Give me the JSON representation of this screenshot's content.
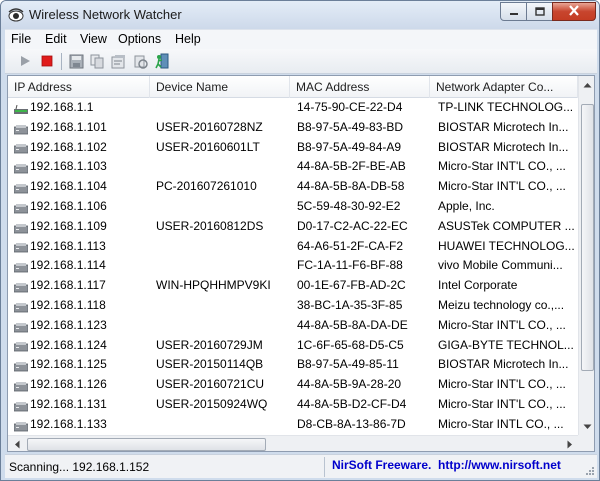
{
  "window": {
    "title": "Wireless Network Watcher",
    "controls": {
      "minimize": "minimize",
      "maximize": "maximize",
      "close": "close"
    }
  },
  "menu": [
    "File",
    "Edit",
    "View",
    "Options",
    "Help"
  ],
  "toolbar": {
    "icons": [
      "play-icon",
      "stop-icon",
      "save-icon",
      "copy-icon",
      "properties-icon",
      "refresh-icon",
      "exit-icon"
    ]
  },
  "table": {
    "columns": [
      "IP Address",
      "Device Name",
      "MAC Address",
      "Network Adapter Co..."
    ],
    "rows": [
      {
        "ip": "192.168.1.1",
        "device": "",
        "mac": "14-75-90-CE-22-D4",
        "vendor": "TP-LINK TECHNOLOG...",
        "icon": "router-icon"
      },
      {
        "ip": "192.168.1.101",
        "device": "USER-20160728NZ",
        "mac": "B8-97-5A-49-83-BD",
        "vendor": "BIOSTAR Microtech In...",
        "icon": "computer-icon"
      },
      {
        "ip": "192.168.1.102",
        "device": "USER-20160601LT",
        "mac": "B8-97-5A-49-84-A9",
        "vendor": "BIOSTAR Microtech In...",
        "icon": "computer-icon"
      },
      {
        "ip": "192.168.1.103",
        "device": "",
        "mac": "44-8A-5B-2F-BE-AB",
        "vendor": "Micro-Star INT'L CO., ...",
        "icon": "computer-icon"
      },
      {
        "ip": "192.168.1.104",
        "device": "PC-201607261010",
        "mac": "44-8A-5B-8A-DB-58",
        "vendor": "Micro-Star INT'L CO., ...",
        "icon": "computer-icon"
      },
      {
        "ip": "192.168.1.106",
        "device": "",
        "mac": "5C-59-48-30-92-E2",
        "vendor": "Apple, Inc.",
        "icon": "computer-icon"
      },
      {
        "ip": "192.168.1.109",
        "device": "USER-20160812DS",
        "mac": "D0-17-C2-AC-22-EC",
        "vendor": "ASUSTek COMPUTER ...",
        "icon": "computer-icon"
      },
      {
        "ip": "192.168.1.113",
        "device": "",
        "mac": "64-A6-51-2F-CA-F2",
        "vendor": "HUAWEI TECHNOLOG...",
        "icon": "computer-icon"
      },
      {
        "ip": "192.168.1.114",
        "device": "",
        "mac": "FC-1A-11-F6-BF-88",
        "vendor": "vivo Mobile Communi...",
        "icon": "computer-icon"
      },
      {
        "ip": "192.168.1.117",
        "device": "WIN-HPQHHMPV9KI",
        "mac": "00-1E-67-FB-AD-2C",
        "vendor": "Intel Corporate",
        "icon": "computer-icon"
      },
      {
        "ip": "192.168.1.118",
        "device": "",
        "mac": "38-BC-1A-35-3F-85",
        "vendor": "Meizu technology co.,...",
        "icon": "computer-icon"
      },
      {
        "ip": "192.168.1.123",
        "device": "",
        "mac": "44-8A-5B-8A-DA-DE",
        "vendor": "Micro-Star INT'L CO., ...",
        "icon": "computer-icon"
      },
      {
        "ip": "192.168.1.124",
        "device": "USER-20160729JM",
        "mac": "1C-6F-65-68-D5-C5",
        "vendor": "GIGA-BYTE TECHNOL...",
        "icon": "computer-icon"
      },
      {
        "ip": "192.168.1.125",
        "device": "USER-20150114QB",
        "mac": "B8-97-5A-49-85-11",
        "vendor": "BIOSTAR Microtech In...",
        "icon": "computer-icon"
      },
      {
        "ip": "192.168.1.126",
        "device": "USER-20160721CU",
        "mac": "44-8A-5B-9A-28-20",
        "vendor": "Micro-Star INT'L CO., ...",
        "icon": "computer-icon"
      },
      {
        "ip": "192.168.1.131",
        "device": "USER-20150924WQ",
        "mac": "44-8A-5B-D2-CF-D4",
        "vendor": "Micro-Star INT'L CO., ...",
        "icon": "computer-icon"
      },
      {
        "ip": "192.168.1.133",
        "device": "",
        "mac": "D8-CB-8A-13-86-7D",
        "vendor": "Micro-Star INTL CO., ...",
        "icon": "computer-icon"
      }
    ]
  },
  "status": {
    "scan_text": "Scanning... 192.168.1.152",
    "link_text": "NirSoft Freeware.  http://www.nirsoft.net"
  },
  "colors": {
    "title_bar": "#cdd9ea",
    "close_button": "#c8452e",
    "stop_icon": "#e01b1b",
    "link": "#0000cc"
  }
}
